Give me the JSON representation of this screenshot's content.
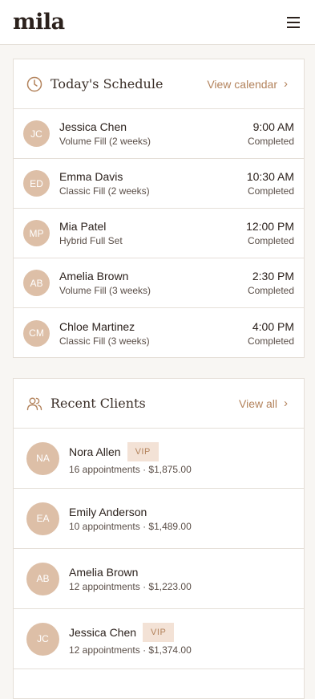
{
  "header": {
    "logo": "mila"
  },
  "schedule": {
    "title": "Today's Schedule",
    "link": "View calendar",
    "items": [
      {
        "initials": "JC",
        "name": "Jessica Chen",
        "service": "Volume Fill (2 weeks)",
        "time": "9:00 AM",
        "status": "Completed"
      },
      {
        "initials": "ED",
        "name": "Emma Davis",
        "service": "Classic Fill (2 weeks)",
        "time": "10:30 AM",
        "status": "Completed"
      },
      {
        "initials": "MP",
        "name": "Mia Patel",
        "service": "Hybrid Full Set",
        "time": "12:00 PM",
        "status": "Completed"
      },
      {
        "initials": "AB",
        "name": "Amelia Brown",
        "service": "Volume Fill (3 weeks)",
        "time": "2:30 PM",
        "status": "Completed"
      },
      {
        "initials": "CM",
        "name": "Chloe Martinez",
        "service": "Classic Fill (3 weeks)",
        "time": "4:00 PM",
        "status": "Completed"
      }
    ]
  },
  "clients": {
    "title": "Recent Clients",
    "link": "View all",
    "items": [
      {
        "initials": "NA",
        "name": "Nora Allen",
        "badge": "VIP",
        "summary": "16 appointments · $1,875.00"
      },
      {
        "initials": "EA",
        "name": "Emily Anderson",
        "badge": "",
        "summary": "10 appointments · $1,489.00"
      },
      {
        "initials": "AB",
        "name": "Amelia Brown",
        "badge": "",
        "summary": "12 appointments · $1,223.00"
      },
      {
        "initials": "JC",
        "name": "Jessica Chen",
        "badge": "VIP",
        "summary": "12 appointments · $1,374.00"
      }
    ]
  },
  "icons": {
    "menu": "hamburger-icon",
    "schedule": "clock-icon",
    "clients": "users-icon",
    "chevron": "chevron-right-icon"
  },
  "colors": {
    "accent": "#b3835c",
    "avatar": "#ddbfa7",
    "vip_bg": "#f3e2d6"
  }
}
